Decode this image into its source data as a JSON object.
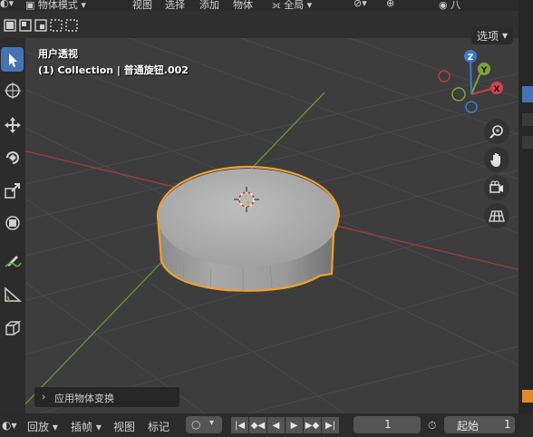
{
  "header": {
    "mode_label": "物体模式",
    "menu": [
      "视图",
      "选择",
      "添加",
      "物体"
    ],
    "orientation_label": "全局",
    "overlay_label": "八"
  },
  "options_label": "选项",
  "overlay": {
    "view_name": "用户透视",
    "collection_object": "(1) Collection | 普通旋钮.002"
  },
  "gizmo": {
    "z": "Z",
    "y": "Y",
    "x": "X"
  },
  "operator_panel": {
    "label": "应用物体变换"
  },
  "timeline": {
    "playback_label": "回放",
    "keying_label": "插帧",
    "view_label": "视图",
    "marker_label": "标记",
    "current_frame": "1",
    "start_label": "起始",
    "start_value": "1"
  },
  "colors": {
    "accent": "#4772b3",
    "selection_outline": "#f0a030",
    "axis_x": "#c04040",
    "axis_y": "#7fa03c"
  },
  "icons": {
    "toolbar": [
      "select-cursor-icon",
      "3d-cursor-icon",
      "move-icon",
      "rotate-icon",
      "scale-icon",
      "transform-icon",
      "annotate-icon",
      "measure-icon",
      "add-cube-icon"
    ],
    "nav": [
      "zoom-icon",
      "hand-pan-icon",
      "camera-icon",
      "grid-ortho-icon"
    ]
  }
}
